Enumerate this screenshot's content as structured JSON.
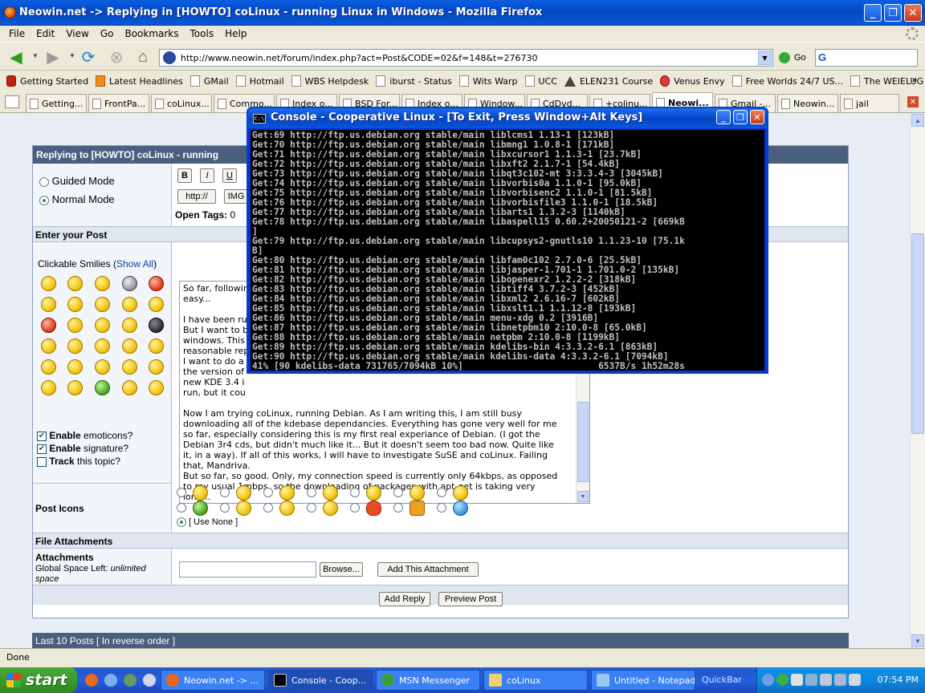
{
  "firefox": {
    "title": "Neowin.net -> Replying in [HOWTO] coLinux - running Linux in Windows - Mozilla Firefox",
    "menu": [
      "File",
      "Edit",
      "View",
      "Go",
      "Bookmarks",
      "Tools",
      "Help"
    ],
    "url": "http://www.neowin.net/forum/index.php?act=Post&CODE=02&f=148&t=276730",
    "go_label": "Go",
    "bookmarks": [
      "Getting Started",
      "Latest Headlines",
      "GMail",
      "Hotmail",
      "WBS Helpdesk",
      "iburst - Status",
      "Wits Warp",
      "UCC",
      "ELEN231 Course",
      "Venus Envy",
      "Free Worlds 24/7 US...",
      "The WEIELUG Forum..."
    ],
    "bookmarks_more": "»",
    "tabs": [
      "Getting...",
      "FrontPa...",
      "coLinux...",
      "Commo...",
      "Index o...",
      "BSD For...",
      "Index o...",
      "Window...",
      "CdDvd...",
      "+colinu...",
      "Neowi...",
      "Gmail -...",
      "Neowin...",
      "jail"
    ],
    "status": "Done"
  },
  "forum": {
    "reply_header": "Replying to [HOWTO] coLinux - running",
    "guided_mode": "Guided Mode",
    "normal_mode": "Normal Mode",
    "bold": "B",
    "italic": "I",
    "underline": "U",
    "http_btn": "http://",
    "img_btn": "IMG",
    "open_tags_label": "Open Tags:",
    "open_tags_value": "0",
    "enter_post": "Enter your Post",
    "smilies_label": "Clickable Smilies (",
    "show_all": "Show All",
    "smilies_close": ")",
    "enable_emoticons_bold": "Enable",
    "enable_emoticons_rest": " emoticons?",
    "enable_signature_bold": "Enable",
    "enable_signature_rest": " signature?",
    "track_bold": "Track",
    "track_rest": " this topic?",
    "post_text": "So far, followin\neasy...\n\nI have been ru\nBut I want to b\nwindows. This \nreasonable rep\nI want to do a\nthe version of \nnew KDE 3.4 i\nrun, but it cou\n\nNow I am trying coLinux, running Debian. As I am writing this, I am still busy\ndownloading all of the kdebase dependancies. Everything has gone very well for me\nso far, especially considering this is my first real experiance of Debian. (I got the\nDebian 3r4 cds, but didn't much like it... But it doesn't seem too bad now. Quite like\nit, in a way). If all of this works, I will have to investigate SuSE and coLinux. Failing\nthat, Mandriva.\nBut so far, so good. Only, my connection speed is currently only 64kbps, as opposed\nto my usual 1mbps, so the downloading of packages with apt-get is taking very\nlong...",
    "post_icons": "Post Icons",
    "use_none": "[ Use None ]",
    "file_attachments": "File Attachments",
    "attachments": "Attachments",
    "space_left_label": "Global Space Left:",
    "space_left_value": "unlimited space",
    "browse": "Browse...",
    "add_attachment": "Add This Attachment",
    "add_reply": "Add Reply",
    "preview_post": "Preview Post",
    "last_posts": "Last 10 Posts [ In reverse order ]"
  },
  "console": {
    "title": "Console - Cooperative Linux - [To Exit, Press Window+Alt Keys]",
    "lines": [
      "Get:69 http://ftp.us.debian.org stable/main liblcms1 1.13-1 [123kB]",
      "Get:70 http://ftp.us.debian.org stable/main libmng1 1.0.8-1 [171kB]",
      "Get:71 http://ftp.us.debian.org stable/main libxcursor1 1.1.3-1 [23.7kB]",
      "Get:72 http://ftp.us.debian.org stable/main libxft2 2.1.7-1 [54.4kB]",
      "Get:73 http://ftp.us.debian.org stable/main libqt3c102-mt 3:3.3.4-3 [3045kB]",
      "Get:74 http://ftp.us.debian.org stable/main libvorbis0a 1.1.0-1 [95.0kB]",
      "Get:75 http://ftp.us.debian.org stable/main libvorbisenc2 1.1.0-1 [81.5kB]",
      "Get:76 http://ftp.us.debian.org stable/main libvorbisfile3 1.1.0-1 [18.5kB]",
      "Get:77 http://ftp.us.debian.org stable/main libarts1 1.3.2-3 [1140kB]",
      "Get:78 http://ftp.us.debian.org stable/main libaspell15 0.60.2+20050121-2 [669kB",
      "]",
      "Get:79 http://ftp.us.debian.org stable/main libcupsys2-gnutls10 1.1.23-10 [75.1k",
      "B]",
      "Get:80 http://ftp.us.debian.org stable/main libfam0c102 2.7.0-6 [25.5kB]",
      "Get:81 http://ftp.us.debian.org stable/main libjasper-1.701-1 1.701.0-2 [135kB]",
      "Get:82 http://ftp.us.debian.org stable/main libopenexr2 1.2.2-2 [318kB]",
      "Get:83 http://ftp.us.debian.org stable/main libtiff4 3.7.2-3 [452kB]",
      "Get:84 http://ftp.us.debian.org stable/main libxml2 2.6.16-7 [602kB]",
      "Get:85 http://ftp.us.debian.org stable/main libxslt1.1 1.1.12-8 [193kB]",
      "Get:86 http://ftp.us.debian.org stable/main menu-xdg 0.2 [3916B]",
      "Get:87 http://ftp.us.debian.org stable/main libnetpbm10 2:10.0-8 [65.0kB]",
      "Get:88 http://ftp.us.debian.org stable/main netpbm 2:10.0-8 [1199kB]",
      "Get:89 http://ftp.us.debian.org stable/main kdelibs-bin 4:3.3.2-6.1 [863kB]",
      "Get:90 http://ftp.us.debian.org stable/main kdelibs-data 4:3.3.2-6.1 [7094kB]",
      "41% [90 kdelibs-data 731765/7094kB 10%]                         6537B/s 1h52m28s"
    ]
  },
  "taskbar": {
    "start": "start",
    "tasks": [
      "Neowin.net -> ...",
      "Console - Coop...",
      "MSN Messenger",
      "coLinux",
      "Untitled - Notepad"
    ],
    "quickbar": "QuickBar",
    "clock": "07:54 PM"
  },
  "colors": {
    "titlebar": "#0348c4",
    "forum_header": "#4a5e7e",
    "taskbar": "#245fdc",
    "console_bg": "#000000"
  }
}
